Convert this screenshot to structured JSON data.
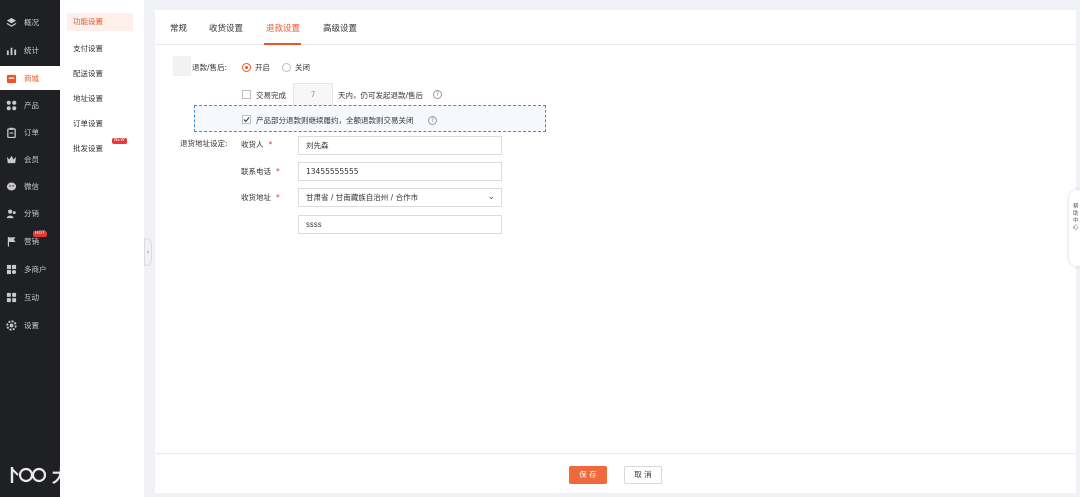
{
  "sidebar": {
    "items": [
      {
        "label": "概况",
        "icon": "layers-icon"
      },
      {
        "label": "统计",
        "icon": "bar-chart-icon"
      },
      {
        "label": "商城",
        "icon": "store-icon"
      },
      {
        "label": "产品",
        "icon": "grid-icon"
      },
      {
        "label": "订单",
        "icon": "clipboard-icon"
      },
      {
        "label": "会员",
        "icon": "crown-icon"
      },
      {
        "label": "微信",
        "icon": "wechat-icon"
      },
      {
        "label": "分销",
        "icon": "users-icon"
      },
      {
        "label": "营销",
        "icon": "flag-icon",
        "badge": "HOT"
      },
      {
        "label": "多商户",
        "icon": "shop-icon"
      },
      {
        "label": "互动",
        "icon": "apps-icon"
      },
      {
        "label": "设置",
        "icon": "gear-icon"
      }
    ]
  },
  "submenu": {
    "items": [
      {
        "label": "功能设置"
      },
      {
        "label": "支付设置"
      },
      {
        "label": "配送设置"
      },
      {
        "label": "地址设置"
      },
      {
        "label": "订单设置"
      },
      {
        "label": "批发设置",
        "badge": "NEW"
      }
    ]
  },
  "tabs": [
    "常规",
    "收货设置",
    "退款设置",
    "高级设置"
  ],
  "form": {
    "refund_label": "退款/售后:",
    "radio_on": "开启",
    "radio_off": "关闭",
    "trade_done_label": "交易完成",
    "days_value": "7",
    "days_suffix": "天内，仍可发起退款/售后",
    "partial_refund_text": "产品部分退款则继续履约，全额退款则交易关闭",
    "return_address_label": "退货地址设定:",
    "receiver_label": "收货人",
    "receiver_value": "刘先森",
    "phone_label": "联系电话",
    "phone_value": "13455555555",
    "address_label": "收货地址",
    "address_value": "甘肃省 / 甘南藏族自治州 / 合作市",
    "address_detail": "ssss",
    "required_mark": "*",
    "help_mark": "?"
  },
  "footer": {
    "save_label": "保 存",
    "cancel_label": "取 消"
  },
  "right_tab": {
    "text": "帮助中心"
  },
  "watermark": {
    "text": "大数跨境"
  },
  "colors": {
    "accent": "#e8552b",
    "sidebar_bg": "#1f2023",
    "dashed_border": "#3d8bd9"
  }
}
